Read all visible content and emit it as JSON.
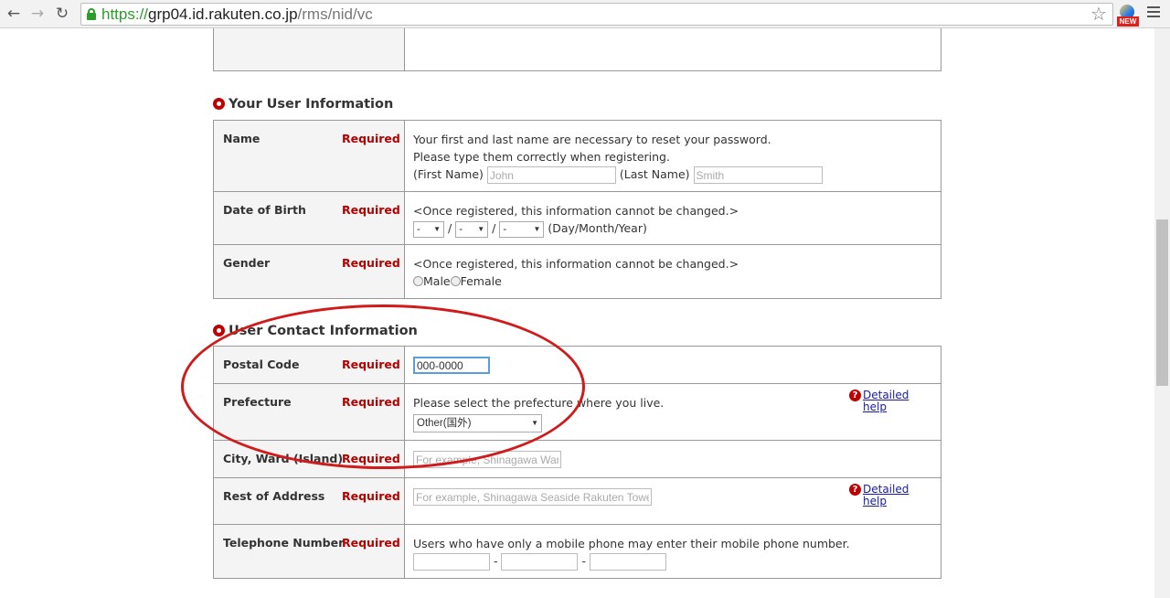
{
  "browser": {
    "url_scheme": "https://",
    "url_host": "grp04.id.rakuten.co.jp",
    "url_path": "/rms/nid/vc",
    "extension_badge": "NEW",
    "icons": [
      "back-arrow-icon",
      "forward-arrow-icon",
      "reload-icon",
      "lock-icon",
      "star-icon",
      "extension-icon",
      "menu-icon"
    ]
  },
  "required_label": "Required",
  "user_info": {
    "title": "Your User Information",
    "name": {
      "label": "Name",
      "note1": "Your first and last name are necessary to reset your password.",
      "note2": "Please type them correctly when registering.",
      "first_label": "(First Name)",
      "first_placeholder": "John",
      "last_label": "(Last Name)",
      "last_placeholder": "Smith"
    },
    "dob": {
      "label": "Date of Birth",
      "note": "<Once registered, this information cannot be changed.>",
      "day": "-",
      "month": "-",
      "year": "-",
      "sep": "/",
      "suffix": "(Day/Month/Year)"
    },
    "gender": {
      "label": "Gender",
      "note": "<Once registered, this information cannot be changed.>",
      "male": "Male",
      "female": "Female"
    }
  },
  "contact_info": {
    "title": "User Contact Information",
    "postal": {
      "label": "Postal Code",
      "value": "000-0000"
    },
    "prefecture": {
      "label": "Prefecture",
      "note": "Please select the prefecture where you live.",
      "selected": "Other(国外)",
      "help_line1": "Detailed",
      "help_line2": "help"
    },
    "city": {
      "label": "City, Ward (Island)",
      "placeholder": "For example, Shinagawa Ward"
    },
    "rest": {
      "label": "Rest of Address",
      "placeholder": "For example, Shinagawa Seaside Rakuten Tower",
      "help_line1": "Detailed",
      "help_line2": "help"
    },
    "phone": {
      "label": "Telephone Number",
      "note": "Users who have only a mobile phone may enter their mobile phone number.",
      "sep": "-"
    }
  },
  "colors": {
    "required": "#b40000",
    "annotation_circle": "#d11a1a",
    "link": "#1a1aa6"
  }
}
